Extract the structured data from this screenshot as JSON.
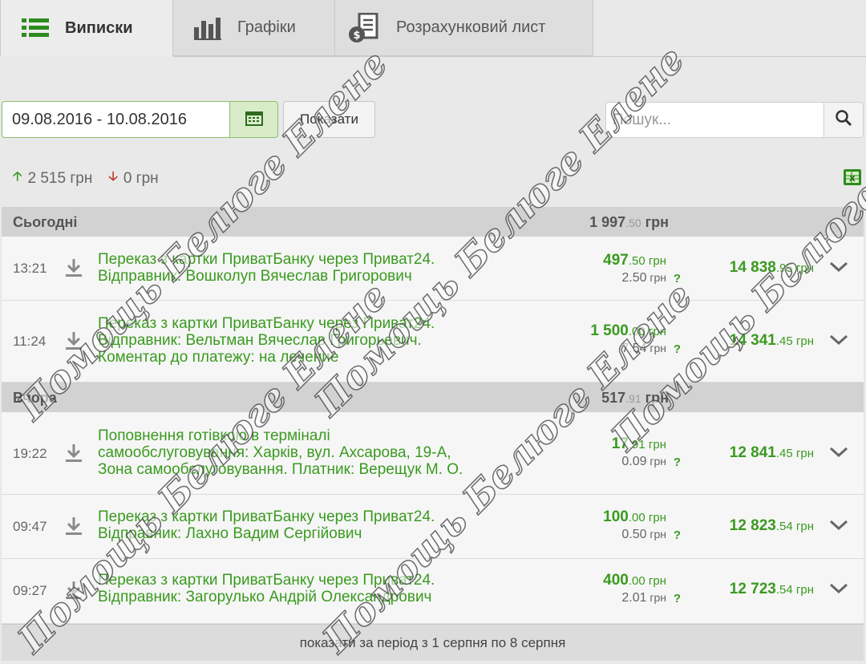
{
  "tabs": [
    {
      "label": "Виписки",
      "icon": "list-icon",
      "active": true
    },
    {
      "label": "Графіки",
      "icon": "bar-chart-icon",
      "active": false
    },
    {
      "label": "Розрахунковий лист",
      "icon": "invoice-icon",
      "active": false
    }
  ],
  "filter": {
    "date_range": "09.08.2016 - 10.08.2016",
    "show_label": "Показати",
    "search_placeholder": "Пошук..."
  },
  "totals": {
    "income": "2 515 грн",
    "expense": "0 грн"
  },
  "groups": [
    {
      "label": "Сьогодні",
      "sum_int": "1 997",
      "sum_dec": ".50",
      "sum_cur": " грн",
      "rows": [
        {
          "time": "13:21",
          "desc": [
            "Переказ з картки ПриватБанку через Приват24.",
            "Відправник: Вошколуп Вячеслав Григорович"
          ],
          "amount_int": "497",
          "amount_dec": ".50",
          "amount_cur": " грн",
          "fee_int": "2.50",
          "fee_cur": " грн",
          "balance_int": "14 838",
          "balance_dec": ".95",
          "balance_cur": " грн"
        },
        {
          "time": "11:24",
          "desc": [
            "Переказ з картки ПриватБанку через Приват24.",
            "Відправник: Вельтман Вячеслав Григорьевич.",
            "Коментар до платежу: на лечение"
          ],
          "amount_int": "1 500",
          "amount_dec": ".00",
          "amount_cur": " грн",
          "fee_int": "7.54",
          "fee_cur": " грн",
          "balance_int": "14 341",
          "balance_dec": ".45",
          "balance_cur": " грн"
        }
      ]
    },
    {
      "label": "Вчора",
      "sum_int": "517",
      "sum_dec": ".91",
      "sum_cur": " грн",
      "rows": [
        {
          "time": "19:22",
          "desc": [
            "Поповнення готівкою в терміналі",
            "самообслуговування: Харків, вул. Ахсарова, 19-А,",
            "Зона самообслуговування. Платник: Верещук М. О."
          ],
          "amount_int": "17",
          "amount_dec": ".91",
          "amount_cur": " грн",
          "fee_int": "0.09",
          "fee_cur": " грн",
          "balance_int": "12 841",
          "balance_dec": ".45",
          "balance_cur": " грн"
        },
        {
          "time": "09:47",
          "desc": [
            "Переказ з картки ПриватБанку через Приват24.",
            "Відправник: Лахно Вадим Сергійович"
          ],
          "amount_int": "100",
          "amount_dec": ".00",
          "amount_cur": " грн",
          "fee_int": "0.50",
          "fee_cur": " грн",
          "balance_int": "12 823",
          "balance_dec": ".54",
          "balance_cur": " грн"
        },
        {
          "time": "09:27",
          "desc": [
            "Переказ з картки ПриватБанку через Приват24.",
            "Відправник: Загорулько Андрій Олександрович"
          ],
          "amount_int": "400",
          "amount_dec": ".00",
          "amount_cur": " грн",
          "fee_int": "2.01",
          "fee_cur": " грн",
          "balance_int": "12 723",
          "balance_dec": ".54",
          "balance_cur": " грн"
        }
      ]
    }
  ],
  "fee_help": "?",
  "footer_link": "показати за період з 1 серпня по 8 серпня",
  "watermark": "Помощь Белюге Елене",
  "colors": {
    "accent_green": "#3a9a1f",
    "expense_red": "#c0392b"
  }
}
